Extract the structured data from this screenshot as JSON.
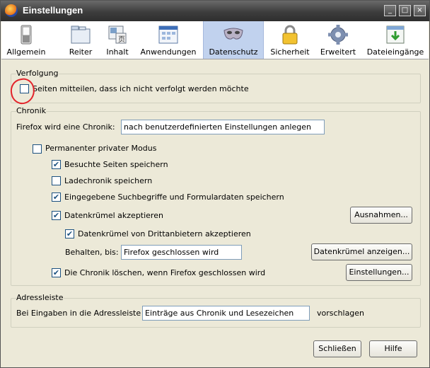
{
  "window": {
    "title": "Einstellungen",
    "minimize": "_",
    "maximize": "□",
    "close": "×"
  },
  "toolbar": {
    "items": [
      {
        "label": "Allgemein",
        "icon": "switch-icon"
      },
      {
        "label": "Reiter",
        "icon": "tabs-icon"
      },
      {
        "label": "Inhalt",
        "icon": "content-icon"
      },
      {
        "label": "Anwendungen",
        "icon": "applications-icon"
      },
      {
        "label": "Datenschutz",
        "icon": "mask-icon"
      },
      {
        "label": "Sicherheit",
        "icon": "lock-icon"
      },
      {
        "label": "Erweitert",
        "icon": "gear-icon"
      },
      {
        "label": "Dateieingänge",
        "icon": "download-icon"
      }
    ],
    "selected": "Datenschutz"
  },
  "tracking": {
    "group_label": "Verfolgung",
    "dnt_label": "Seiten mitteilen, dass ich nicht verfolgt werden möchte",
    "dnt_checked": false
  },
  "history": {
    "group_label": "Chronik",
    "mode_label": "Firefox wird eine Chronik:",
    "mode_value": "nach benutzerdefinierten Einstellungen anlegen",
    "private_label": "Permanenter privater Modus",
    "private_checked": false,
    "visited_label": "Besuchte Seiten speichern",
    "visited_checked": true,
    "downloads_label": "Ladechronik speichern",
    "downloads_checked": false,
    "forms_label": "Eingegebene Suchbegriffe und Formulardaten speichern",
    "forms_checked": true,
    "cookies_label": "Datenkrümel akzeptieren",
    "cookies_checked": true,
    "exceptions_button": "Ausnahmen...",
    "thirdparty_label": "Datenkrümel von Drittanbietern akzeptieren",
    "thirdparty_checked": true,
    "keep_label": "Behalten, bis:",
    "keep_value": "Firefox geschlossen wird",
    "show_cookies_button": "Datenkrümel anzeigen...",
    "clear_label": "Die Chronik löschen, wenn Firefox geschlossen wird",
    "clear_checked": true,
    "settings_button": "Einstellungen..."
  },
  "urlbar": {
    "group_label": "Adressleiste",
    "prefix_label": "Bei Eingaben in die Adressleiste",
    "suggest_value": "Einträge aus Chronik und Lesezeichen",
    "suffix_label": "vorschlagen"
  },
  "footer": {
    "close_button": "Schließen",
    "help_button": "Hilfe"
  },
  "marks": {
    "check": "✔"
  }
}
